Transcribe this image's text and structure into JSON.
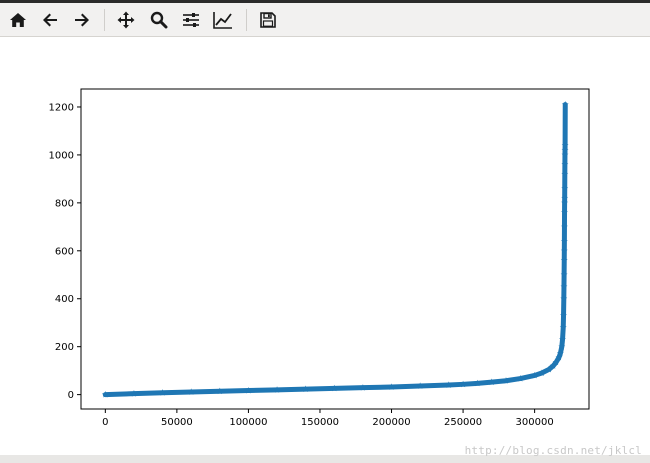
{
  "toolbar": {
    "tools": [
      {
        "name": "home-icon",
        "tooltip": "Home"
      },
      {
        "name": "back-arrow-icon",
        "tooltip": "Back"
      },
      {
        "name": "forward-arrow-icon",
        "tooltip": "Forward"
      },
      {
        "name": "pan-icon",
        "tooltip": "Pan"
      },
      {
        "name": "zoom-icon",
        "tooltip": "Zoom"
      },
      {
        "name": "configure-subplots-icon",
        "tooltip": "Subplots"
      },
      {
        "name": "edit-axis-icon",
        "tooltip": "Customize"
      },
      {
        "name": "save-icon",
        "tooltip": "Save"
      }
    ]
  },
  "watermark": "http://blog.csdn.net/jklcl",
  "colors": {
    "marker": "#1f77b4",
    "toolbar_bg": "#f2f1f0"
  },
  "chart_data": {
    "type": "scatter",
    "marker": "*",
    "series": [
      {
        "color": "#1f77b4",
        "points": [
          [
            0,
            0
          ],
          [
            20000,
            4
          ],
          [
            40000,
            8
          ],
          [
            60000,
            11
          ],
          [
            80000,
            14
          ],
          [
            100000,
            17
          ],
          [
            120000,
            20
          ],
          [
            140000,
            23
          ],
          [
            160000,
            26
          ],
          [
            180000,
            29
          ],
          [
            200000,
            32
          ],
          [
            220000,
            36
          ],
          [
            240000,
            40
          ],
          [
            250000,
            43
          ],
          [
            260000,
            47
          ],
          [
            270000,
            52
          ],
          [
            280000,
            58
          ],
          [
            290000,
            67
          ],
          [
            300000,
            80
          ],
          [
            305000,
            90
          ],
          [
            310000,
            105
          ],
          [
            313000,
            120
          ],
          [
            315000,
            135
          ],
          [
            317000,
            155
          ],
          [
            318000,
            172
          ],
          [
            319000,
            200
          ],
          [
            319500,
            230
          ],
          [
            320000,
            280
          ],
          [
            320200,
            330
          ],
          [
            320400,
            400
          ],
          [
            320500,
            450
          ],
          [
            320600,
            500
          ],
          [
            320700,
            560
          ],
          [
            320750,
            600
          ],
          [
            320800,
            640
          ],
          [
            320850,
            700
          ],
          [
            320900,
            760
          ],
          [
            320950,
            800
          ],
          [
            321000,
            820
          ],
          [
            321050,
            860
          ],
          [
            321100,
            920
          ],
          [
            321150,
            960
          ],
          [
            321200,
            1000
          ],
          [
            321250,
            1020
          ],
          [
            321300,
            1040
          ],
          [
            321400,
            1210
          ]
        ]
      }
    ],
    "xlim": [
      -17000,
      338000
    ],
    "ylim": [
      -60,
      1275
    ],
    "xticks": [
      0,
      50000,
      100000,
      150000,
      200000,
      250000,
      300000
    ],
    "xtick_labels": [
      "0",
      "50000",
      "100000",
      "150000",
      "200000",
      "250000",
      "300000"
    ],
    "yticks": [
      0,
      200,
      400,
      600,
      800,
      1000,
      1200
    ],
    "ytick_labels": [
      "0",
      "200",
      "400",
      "600",
      "800",
      "1000",
      "1200"
    ],
    "title": "",
    "xlabel": "",
    "ylabel": "",
    "grid": false
  }
}
